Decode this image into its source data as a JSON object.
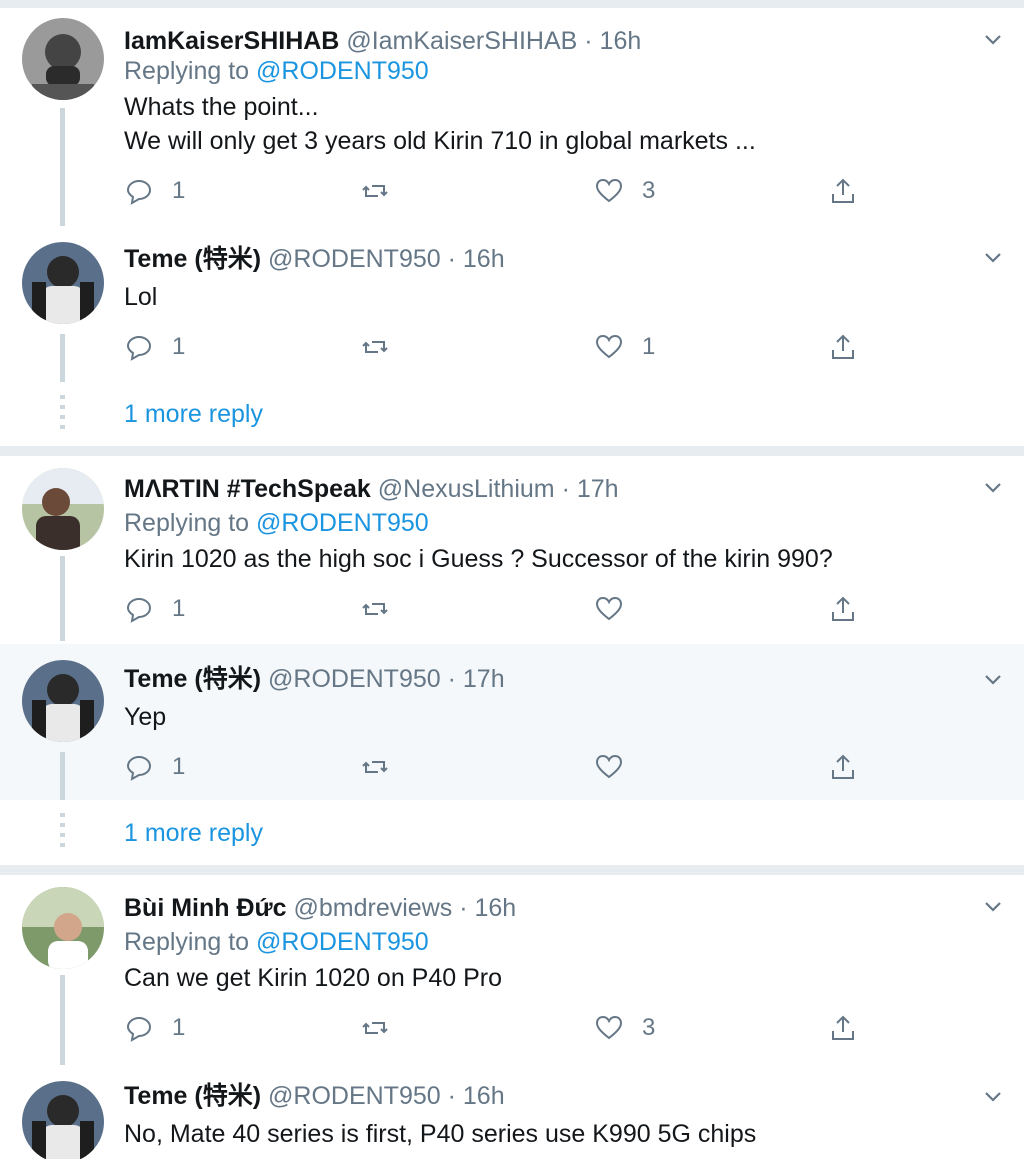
{
  "tweets": [
    {
      "name": "IamKaiserSHIHAB",
      "handle": "@IamKaiserSHIHAB",
      "time": "· 16h",
      "replying_prefix": "Replying to",
      "replying_to": "@RODENT950",
      "lines": [
        "Whats the point...",
        "We will only get 3 years old Kirin 710 in global markets ..."
      ],
      "replies": "1",
      "retweets": "",
      "likes": "3"
    },
    {
      "name": "Teme (特米)",
      "handle": "@RODENT950",
      "time": "· 16h",
      "lines": [
        "Lol"
      ],
      "replies": "1",
      "retweets": "",
      "likes": "1"
    },
    {
      "name": "MΛRTIN #TechSpeak",
      "handle": "@NexusLithium",
      "time": "· 17h",
      "replying_prefix": "Replying to",
      "replying_to": "@RODENT950",
      "lines": [
        "Kirin 1020 as the high soc i Guess ? Successor of the kirin 990?"
      ],
      "replies": "1",
      "retweets": "",
      "likes": ""
    },
    {
      "name": "Teme (特米)",
      "handle": "@RODENT950",
      "time": "· 17h",
      "lines": [
        "Yep"
      ],
      "replies": "1",
      "retweets": "",
      "likes": ""
    },
    {
      "name": "Bùi Minh Đức",
      "handle": "@bmdreviews",
      "time": "· 16h",
      "replying_prefix": "Replying to",
      "replying_to": "@RODENT950",
      "lines": [
        "Can we get Kirin 1020 on P40 Pro"
      ],
      "replies": "1",
      "retweets": "",
      "likes": "3"
    },
    {
      "name": "Teme (特米)",
      "handle": "@RODENT950",
      "time": "· 16h",
      "lines": [
        "No, Mate 40 series is first, P40 series use K990 5G chips"
      ]
    }
  ],
  "more_replies": [
    "1 more reply",
    "1 more reply"
  ],
  "colors": {
    "link": "#1b95e0",
    "meta": "#657786",
    "highlight": "#f5f8fa",
    "separator": "#e6ecf0"
  },
  "icons": [
    "avatar",
    "chevron-down-icon",
    "reply-icon",
    "retweet-icon",
    "like-icon",
    "share-icon"
  ]
}
